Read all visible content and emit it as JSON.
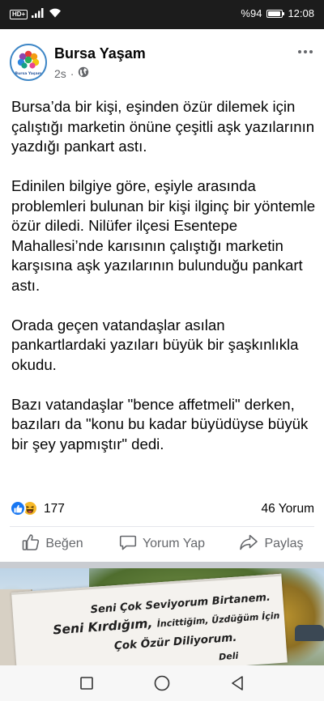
{
  "status_bar": {
    "network_badge": "HD+",
    "battery_text": "%94",
    "battery_level": 0.94,
    "time": "12:08"
  },
  "post": {
    "page_name": "Bursa Yaşam",
    "avatar_text": "Bursa Yaşam",
    "time_ago": "2s",
    "separator": "·",
    "audience_icon": "globe-icon",
    "paragraphs": [
      "Bursa’da bir kişi, eşinden özür dilemek için çalıştığı marketin önüne çeşitli aşk yazılarının yazdığı pankart astı.",
      "Edinilen bilgiye göre, eşiyle arasında problemleri bulunan bir kişi ilginç bir yöntemle özür diledi. Nilüfer ilçesi Esentepe Mahallesi’nde karısının çalıştığı marketin karşısına aşk yazılarının bulunduğu pankart astı.",
      "Orada geçen vatandaşlar asılan pankartlardaki yazıları büyük bir şaşkınlıkla okudu.",
      "Bazı vatandaşlar \"bence affetmeli\" derken, bazıları da \"konu bu kadar büyüdüyse büyük bir şey yapmıştır\" dedi."
    ],
    "reaction_count": "177",
    "comment_count": "46 Yorum",
    "actions": {
      "like": "Beğen",
      "comment": "Yorum Yap",
      "share": "Paylaş"
    }
  },
  "next_post": {
    "banner_line_1": "Seni Çok Seviyorum Birtanem.",
    "banner_line_2a": "Seni Kırdığım, ",
    "banner_line_2b": "İncittiğim, Üzdüğüm İçin",
    "banner_line_3": "Çok Özür Diliyorum.",
    "banner_line_4": "Deli"
  },
  "colors": {
    "accent": "#1877f2",
    "haha": "#f7b928",
    "secondary_text": "#65676b",
    "avatar_ring": "#3d86c6"
  },
  "icons": {
    "like_reaction": "thumbs-up-icon",
    "haha_reaction": "haha-face-icon",
    "like_action": "thumbs-up-outline-icon",
    "comment_action": "speech-bubble-icon",
    "share_action": "share-arrow-icon",
    "nav_recent": "square-icon",
    "nav_home": "circle-icon",
    "nav_back": "triangle-back-icon"
  }
}
